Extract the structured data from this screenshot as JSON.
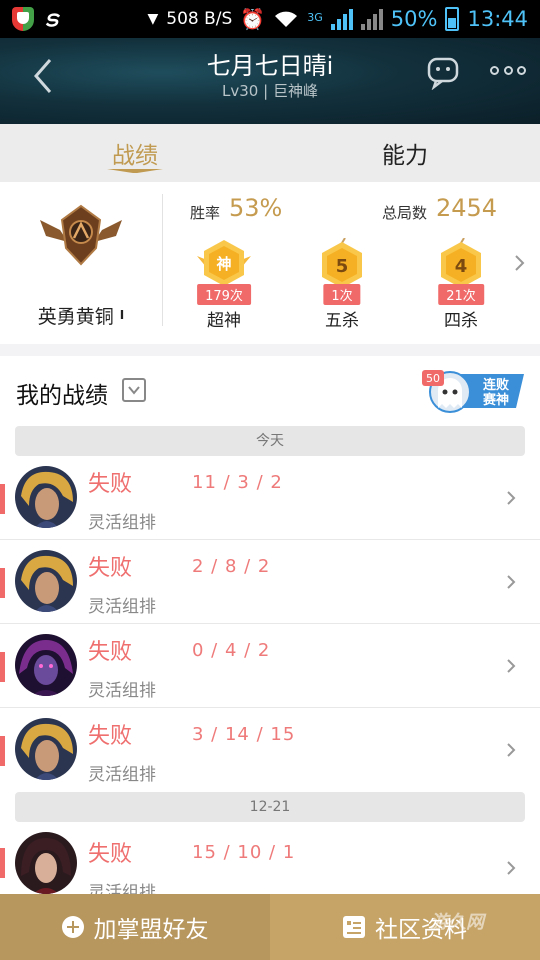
{
  "status_bar": {
    "speed": "508 B/S",
    "network": "3G",
    "battery": "50%",
    "time": "13:44"
  },
  "header": {
    "title": "七月七日晴i",
    "subtitle": "Lv30 | 巨神峰"
  },
  "tabs": [
    {
      "label": "战绩",
      "active": true
    },
    {
      "label": "能力",
      "active": false
    }
  ],
  "summary": {
    "rank_name": "英勇黄铜",
    "rank_tier": "I",
    "win_rate_label": "胜率",
    "win_rate_value": "53%",
    "total_games_label": "总局数",
    "total_games_value": "2454",
    "achievements": [
      {
        "badge": "神",
        "count": "179次",
        "name": "超神"
      },
      {
        "badge": "5",
        "count": "1次",
        "name": "五杀"
      },
      {
        "badge": "4",
        "count": "21次",
        "name": "四杀"
      }
    ]
  },
  "records": {
    "title": "我的战绩",
    "streak_count": "50",
    "streak_text_1": "连败",
    "streak_text_2": "赛神",
    "groups": [
      {
        "date": "今天"
      },
      {
        "date": "12-21"
      }
    ],
    "matches": [
      {
        "result": "失败",
        "kda": "11 / 3 / 2",
        "mode": "灵活组排",
        "avatar": "golden-hair-champion"
      },
      {
        "result": "失败",
        "kda": "2 / 8 / 2",
        "mode": "灵活组排",
        "avatar": "golden-hair-champion"
      },
      {
        "result": "失败",
        "kda": "0 / 4 / 2",
        "mode": "灵活组排",
        "avatar": "purple-champion"
      },
      {
        "result": "失败",
        "kda": "3 / 14 / 15",
        "mode": "灵活组排",
        "avatar": "golden-hair-champion"
      },
      {
        "result": "失败",
        "kda": "15 / 10 / 1",
        "mode": "灵活组排",
        "avatar": "dark-hair-champion"
      }
    ]
  },
  "bottom_bar": {
    "add_friend": "加掌盟好友",
    "community": "社区资料"
  },
  "watermark": "游久网",
  "colors": {
    "accent_gold": "#c09a50",
    "loss_red": "#ef6e6e",
    "header_dark": "#12303c"
  }
}
